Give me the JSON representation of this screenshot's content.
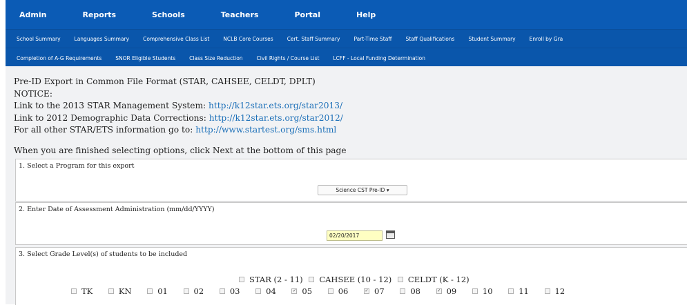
{
  "nav": {
    "main": [
      "Admin",
      "Reports",
      "Schools",
      "Teachers",
      "Portal",
      "Help"
    ],
    "sub1": [
      "School Summary",
      "Languages Summary",
      "Comprehensive Class List",
      "NCLB Core Courses",
      "Cert. Staff Summary",
      "Part-Time Staff",
      "Staff Qualifications",
      "Student Summary",
      "Enroll by Gra"
    ],
    "sub2": [
      "Completion of A-G Requirements",
      "SNOR Eligible Students",
      "Class Size Reduction",
      "Civil Rights / Course List",
      "LCFF - Local Funding Determination"
    ]
  },
  "header": {
    "title": "Pre-ID Export in Common File Format (STAR, CAHSEE, CELDT, DPLT)",
    "notice": "NOTICE:",
    "link1_text": "Link to the 2013 STAR Management System: ",
    "link1_url": "http://k12star.ets.org/star2013/",
    "link2_text": "Link to 2012 Demographic Data Corrections: ",
    "link2_url": "http://k12star.ets.org/star2012/",
    "link3_text": "For all other STAR/ETS information go to: ",
    "link3_url": "http://www.startest.org/sms.html"
  },
  "instructions": "When you are finished selecting options, click Next at the bottom of this page",
  "step1": {
    "label": "1. Select a Program for this export",
    "selected": "Science CST Pre-ID ▾"
  },
  "step2": {
    "label": "2. Enter Date of Assessment Administration (mm/dd/YYYY)",
    "value": "02/20/2017"
  },
  "step3": {
    "label": "3. Select Grade Level(s) of students to be included",
    "tests": [
      {
        "label": "STAR (2 - 11)",
        "checked": false
      },
      {
        "label": "CAHSEE (10 - 12)",
        "checked": false
      },
      {
        "label": "CELDT (K - 12)",
        "checked": false
      }
    ],
    "grades": [
      {
        "label": "TK",
        "checked": false
      },
      {
        "label": "KN",
        "checked": false
      },
      {
        "label": "01",
        "checked": false
      },
      {
        "label": "02",
        "checked": false
      },
      {
        "label": "03",
        "checked": false
      },
      {
        "label": "04",
        "checked": false
      },
      {
        "label": "05",
        "checked": true
      },
      {
        "label": "06",
        "checked": false
      },
      {
        "label": "07",
        "checked": true
      },
      {
        "label": "08",
        "checked": false
      },
      {
        "label": "09",
        "checked": true
      },
      {
        "label": "10",
        "checked": false
      },
      {
        "label": "11",
        "checked": false
      },
      {
        "label": "12",
        "checked": false
      }
    ]
  },
  "colors": {
    "nav": "#0b5bb5",
    "link": "#1b6fb8",
    "date_bg": "#ffffc2"
  }
}
